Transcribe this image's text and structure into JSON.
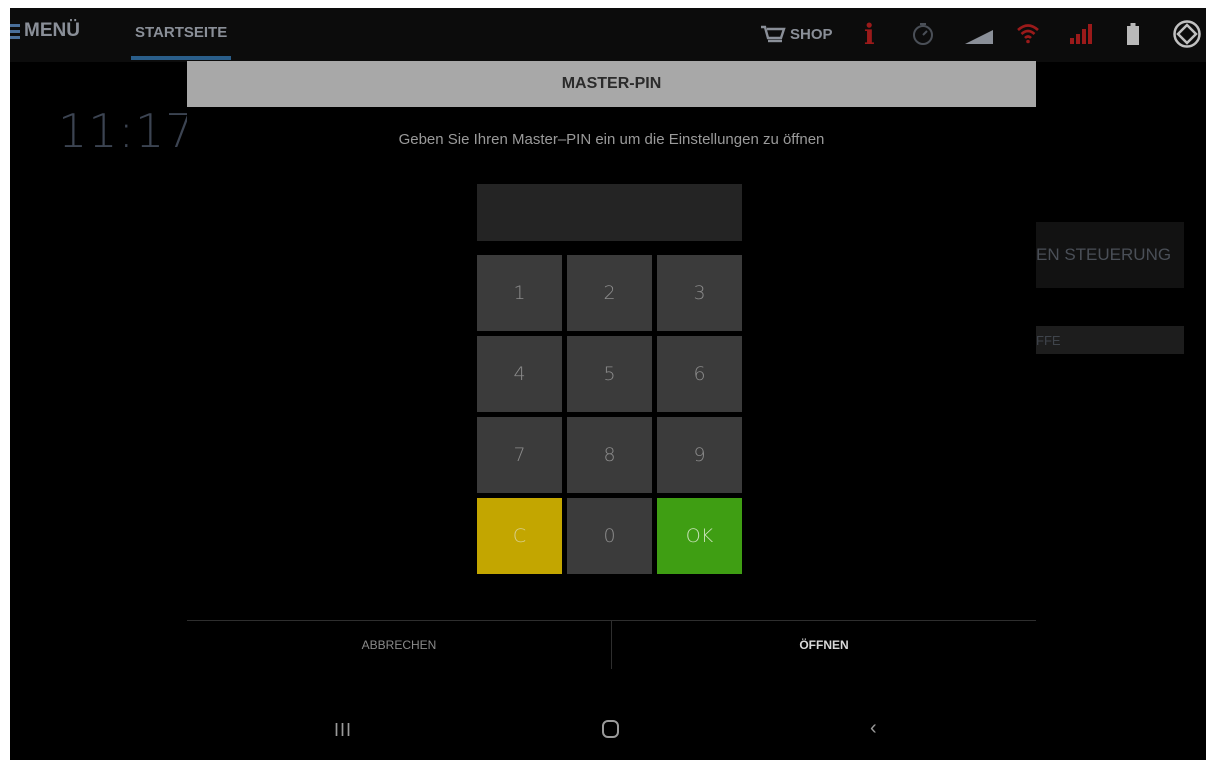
{
  "topbar": {
    "menu_label": "MENÜ",
    "tab_start": "STARTSEITE",
    "shop_label": "SHOP",
    "info_label": "i",
    "icons": [
      "menu-icon",
      "cart-icon",
      "info-icon",
      "timer-icon",
      "signal-icon",
      "wifi-icon",
      "cellular-bars-icon",
      "battery-icon",
      "app-logo-icon"
    ],
    "colors": {
      "accent": "#2a5e8a",
      "alert": "#9b1a1a"
    }
  },
  "background": {
    "clock": "11:17",
    "steuerung_label": "EN STEUERUNG",
    "field_label": "FFE"
  },
  "dialog": {
    "title": "MASTER-PIN",
    "message": "Geben Sie Ihren Master–PIN ein um die Einstellungen zu öffnen",
    "pin_value": "",
    "keys": {
      "k1": "1",
      "k2": "2",
      "k3": "3",
      "k4": "4",
      "k5": "5",
      "k6": "6",
      "k7": "7",
      "k8": "8",
      "k9": "9",
      "clear": "C",
      "k0": "0",
      "ok": "OK"
    },
    "cancel_label": "ABBRECHEN",
    "open_label": "ÖFFNEN",
    "colors": {
      "clear": "#c3a600",
      "ok": "#3f9e13",
      "header": "#a8a8a8"
    }
  },
  "navbar": {
    "recent_label": "III",
    "back_label": "‹"
  }
}
